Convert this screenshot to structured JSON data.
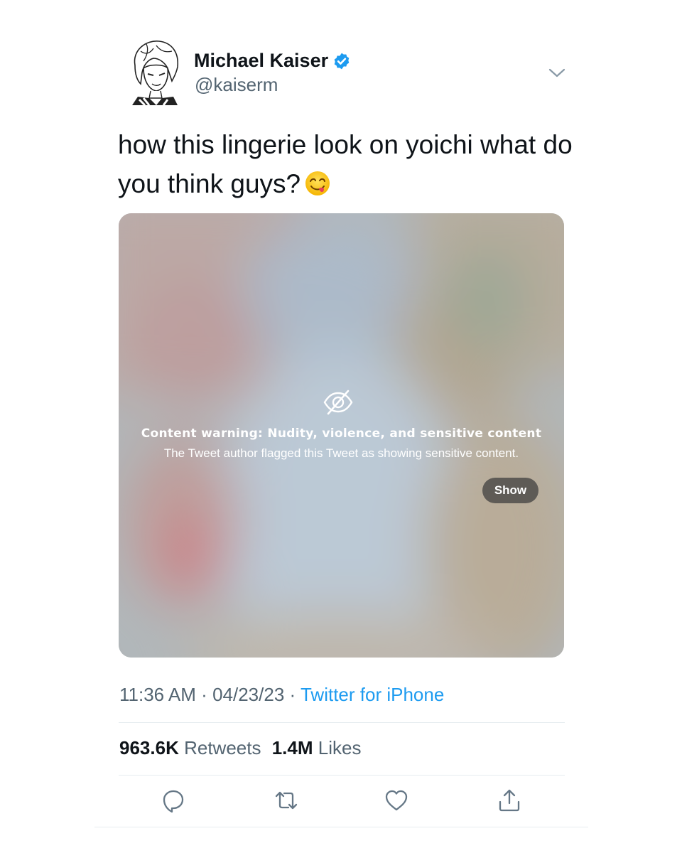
{
  "author": {
    "name": "Michael Kaiser",
    "handle": "@kaiserm",
    "verified": true,
    "verified_color": "#1d9bf0"
  },
  "tweet": {
    "text": "how this lingerie look on yoichi what do you think guys?",
    "emoji": "face-savoring-food-emoji"
  },
  "media": {
    "warning_title": "Content warning: Nudity, violence, and sensitive content",
    "warning_subtitle": "The Tweet author flagged this Tweet as showing sensitive content.",
    "show_label": "Show",
    "icon": "eye-slash-icon"
  },
  "meta": {
    "time": "11:36 AM",
    "separator": "·",
    "date": "04/23/23",
    "source": "Twitter for iPhone"
  },
  "stats": {
    "retweets_count": "963.6K",
    "retweets_label": "Retweets",
    "likes_count": "1.4M",
    "likes_label": "Likes"
  },
  "actions": {
    "reply_icon": "reply-icon",
    "retweet_icon": "retweet-icon",
    "like_icon": "heart-icon",
    "share_icon": "share-icon"
  },
  "colors": {
    "text": "#0f1419",
    "secondary": "#536471",
    "link": "#1d9bf0",
    "divider": "#e6ecf0"
  }
}
